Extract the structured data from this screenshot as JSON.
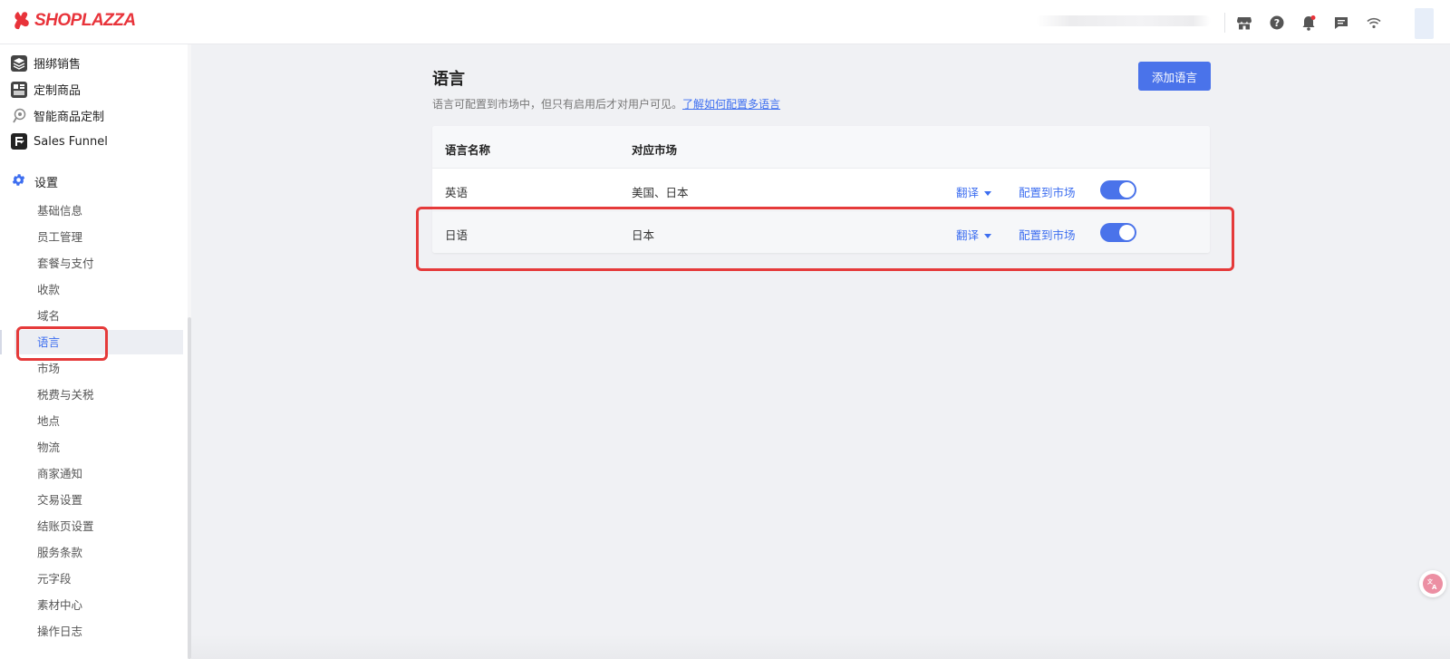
{
  "brand": {
    "name": "SHOPLAZZA",
    "color": "#e8333a"
  },
  "header": {
    "icons": [
      "store-icon",
      "help-icon",
      "bell-icon",
      "chat-icon",
      "wifi-icon"
    ],
    "notification_dot": true
  },
  "sidebar": {
    "apps": [
      {
        "label": "捆绑销售",
        "icon": "layers-icon"
      },
      {
        "label": "定制商品",
        "icon": "customize-icon"
      },
      {
        "label": "智能商品定制",
        "icon": "ai-custom-icon"
      },
      {
        "label": "Sales Funnel",
        "icon": "funnel-app-icon"
      }
    ],
    "settings_label": "设置",
    "settings_items": [
      "基础信息",
      "员工管理",
      "套餐与支付",
      "收款",
      "域名",
      "语言",
      "市场",
      "税费与关税",
      "地点",
      "物流",
      "商家通知",
      "交易设置",
      "结账页设置",
      "服务条款",
      "元字段",
      "素材中心",
      "操作日志"
    ],
    "active_item": "语言"
  },
  "main": {
    "title": "语言",
    "description": "语言可配置到市场中，但只有启用后才对用户可见。",
    "help_link": "了解如何配置多语言",
    "add_button": "添加语言",
    "table": {
      "headers": {
        "name": "语言名称",
        "market": "对应市场"
      },
      "rows": [
        {
          "name": "英语",
          "market": "美国、日本",
          "translate": "翻译",
          "configure": "配置到市场",
          "enabled": true
        },
        {
          "name": "日语",
          "market": "日本",
          "translate": "翻译",
          "configure": "配置到市场",
          "enabled": true
        }
      ]
    }
  },
  "accent_color": "#4a73ea",
  "highlight_color": "#e53a3a"
}
